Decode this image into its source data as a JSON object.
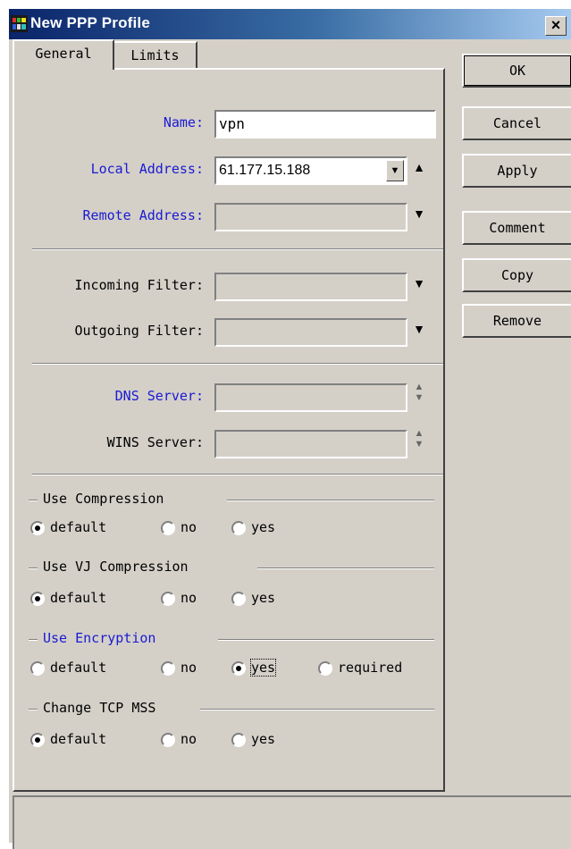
{
  "window": {
    "title": "New PPP Profile",
    "close_label": "×"
  },
  "tabs": [
    {
      "label": "General",
      "active": true
    },
    {
      "label": "Limits",
      "active": false
    }
  ],
  "fields": {
    "name": {
      "label": "Name:",
      "value": "vpn"
    },
    "local_address": {
      "label": "Local Address:",
      "value": "61.177.15.188"
    },
    "remote_address": {
      "label": "Remote Address:",
      "value": ""
    },
    "incoming_filter": {
      "label": "Incoming Filter:",
      "value": ""
    },
    "outgoing_filter": {
      "label": "Outgoing Filter:",
      "value": ""
    },
    "dns_server": {
      "label": "DNS Server:",
      "value": ""
    },
    "wins_server": {
      "label": "WINS Server:",
      "value": ""
    }
  },
  "groups": {
    "use_compression": {
      "title": "Use Compression",
      "options": [
        "default",
        "no",
        "yes"
      ],
      "selected": "default"
    },
    "use_vj_compression": {
      "title": "Use VJ Compression",
      "options": [
        "default",
        "no",
        "yes"
      ],
      "selected": "default"
    },
    "use_encryption": {
      "title": "Use Encryption",
      "options": [
        "default",
        "no",
        "yes",
        "required"
      ],
      "selected": "yes"
    },
    "change_tcp_mss": {
      "title": "Change TCP MSS",
      "options": [
        "default",
        "no",
        "yes"
      ],
      "selected": "default"
    }
  },
  "buttons": {
    "ok": "OK",
    "cancel": "Cancel",
    "apply": "Apply",
    "comment": "Comment",
    "copy": "Copy",
    "remove": "Remove"
  },
  "colors": {
    "label_blue": "#1a1ad2",
    "title_gradient_start": "#0a246a",
    "face": "#d4d0c8"
  },
  "icons": {
    "dropdown": "dropdown-arrow-icon",
    "expand_up": "up-triangle-icon",
    "expand_down": "down-triangle-icon",
    "spin": "up-down-spinner-icon"
  }
}
